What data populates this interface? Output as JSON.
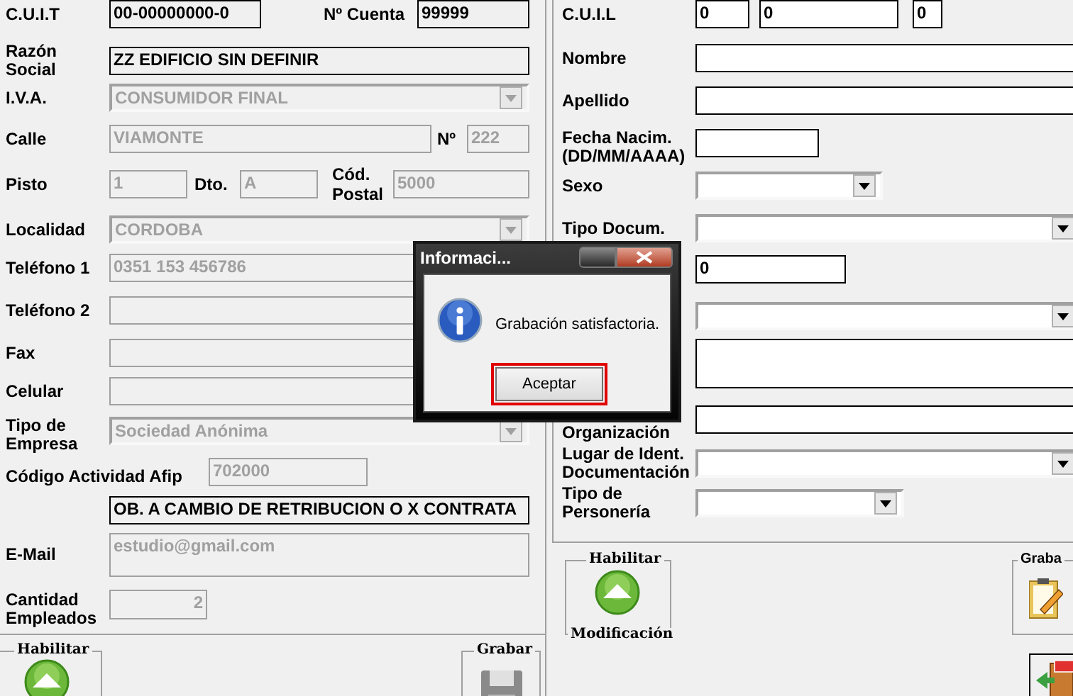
{
  "left": {
    "rows": [
      {
        "parts": [
          {
            "kind": "label",
            "text": "C.U.I.T"
          },
          {
            "kind": "text",
            "value": "00-00000000-0",
            "disabled": false
          },
          {
            "kind": "label",
            "text": "Nº Cuenta"
          },
          {
            "kind": "text",
            "value": "99999",
            "disabled": false
          }
        ]
      },
      {
        "parts": [
          {
            "kind": "label",
            "text": "Razón Social"
          },
          {
            "kind": "text",
            "value": "ZZ EDIFICIO SIN DEFINIR",
            "disabled": false
          }
        ]
      },
      {
        "parts": [
          {
            "kind": "label",
            "text": "I.V.A."
          },
          {
            "kind": "select",
            "value": "CONSUMIDOR FINAL",
            "disabled": true
          }
        ]
      },
      {
        "parts": [
          {
            "kind": "label",
            "text": "Calle"
          },
          {
            "kind": "text",
            "value": "VIAMONTE",
            "disabled": true
          },
          {
            "kind": "label",
            "text": "Nº"
          },
          {
            "kind": "text",
            "value": "222",
            "disabled": true
          }
        ]
      },
      {
        "parts": [
          {
            "kind": "label",
            "text": "Pisto"
          },
          {
            "kind": "text",
            "value": "1",
            "disabled": true
          },
          {
            "kind": "label",
            "text": "Dto."
          },
          {
            "kind": "text",
            "value": "A",
            "disabled": true
          },
          {
            "kind": "label",
            "text": "Cód. Postal"
          },
          {
            "kind": "text",
            "value": "5000",
            "disabled": true
          }
        ]
      },
      {
        "parts": [
          {
            "kind": "label",
            "text": "Localidad"
          },
          {
            "kind": "select",
            "value": "CORDOBA",
            "disabled": true
          }
        ]
      },
      {
        "parts": [
          {
            "kind": "label",
            "text": "Teléfono 1"
          },
          {
            "kind": "text",
            "value": "0351 153 456786",
            "disabled": true
          }
        ]
      },
      {
        "parts": [
          {
            "kind": "label",
            "text": "Teléfono 2"
          },
          {
            "kind": "text",
            "disabled": true
          }
        ]
      },
      {
        "parts": [
          {
            "kind": "label",
            "text": "Fax"
          },
          {
            "kind": "text",
            "disabled": true
          }
        ]
      },
      {
        "parts": [
          {
            "kind": "label",
            "text": "Celular"
          },
          {
            "kind": "text",
            "disabled": true
          }
        ]
      },
      {
        "parts": [
          {
            "kind": "label",
            "text": "Tipo de Empresa"
          },
          {
            "kind": "select",
            "value": "Sociedad Anónima",
            "disabled": true
          }
        ]
      },
      {
        "parts": [
          {
            "kind": "label",
            "text": "Código Actividad Afip"
          },
          {
            "kind": "text",
            "value": "702000",
            "disabled": true
          }
        ]
      },
      {
        "parts": [
          {
            "kind": "text",
            "value": "OB. A CAMBIO DE RETRIBUCION O X CONTRATA",
            "disabled": false
          }
        ]
      },
      {
        "parts": [
          {
            "kind": "label",
            "text": "E-Mail"
          },
          {
            "kind": "text",
            "value": "estudio@gmail.com",
            "disabled": true
          }
        ]
      },
      {
        "parts": [
          {
            "kind": "label",
            "text": "Cantidad Empleados"
          },
          {
            "kind": "text",
            "value": "2",
            "disabled": true
          }
        ]
      }
    ],
    "groups": [
      {
        "legend": "Habilitar"
      },
      {
        "legend": "Grabar"
      }
    ]
  },
  "right": {
    "rows": [
      {
        "parts": [
          {
            "kind": "label",
            "text": "C.U.I.L"
          },
          {
            "kind": "text",
            "value": "0",
            "disabled": false
          },
          {
            "kind": "text",
            "value": "0",
            "disabled": false
          },
          {
            "kind": "text",
            "value": "0",
            "disabled": false
          }
        ]
      },
      {
        "parts": [
          {
            "kind": "label",
            "text": "Nombre"
          },
          {
            "kind": "text",
            "disabled": false
          }
        ]
      },
      {
        "parts": [
          {
            "kind": "label",
            "text": "Apellido"
          },
          {
            "kind": "text",
            "disabled": false
          }
        ]
      },
      {
        "parts": [
          {
            "kind": "label",
            "text": "Fecha Nacim. (DD/MM/AAAA)"
          },
          {
            "kind": "text",
            "disabled": false
          }
        ]
      },
      {
        "parts": [
          {
            "kind": "label",
            "text": "Sexo"
          },
          {
            "kind": "select",
            "disabled": false
          }
        ]
      },
      {
        "parts": [
          {
            "kind": "label",
            "text": "Tipo Docum."
          },
          {
            "kind": "select",
            "disabled": false
          }
        ]
      },
      {
        "parts": [
          {
            "kind": "text",
            "value": "0",
            "disabled": false
          }
        ]
      },
      {
        "parts": [
          {
            "kind": "select",
            "disabled": false
          }
        ]
      },
      {
        "parts": [
          {
            "kind": "text",
            "disabled": false
          }
        ]
      },
      {
        "parts": [
          {
            "kind": "label",
            "text": "Organización"
          },
          {
            "kind": "text",
            "disabled": false
          }
        ]
      },
      {
        "parts": [
          {
            "kind": "label",
            "text": "Lugar de Ident. Documentación"
          },
          {
            "kind": "select",
            "disabled": false
          }
        ]
      },
      {
        "parts": [
          {
            "kind": "label",
            "text": "Tipo de Personería"
          },
          {
            "kind": "select",
            "disabled": false
          }
        ]
      }
    ],
    "groups": [
      {
        "legend": "Habilitar",
        "caption": "Modificación"
      },
      {
        "legend": "Graba"
      }
    ]
  },
  "dialog": {
    "title": "Informaci...",
    "message": "Grabación satisfactoria.",
    "button": "Aceptar"
  }
}
